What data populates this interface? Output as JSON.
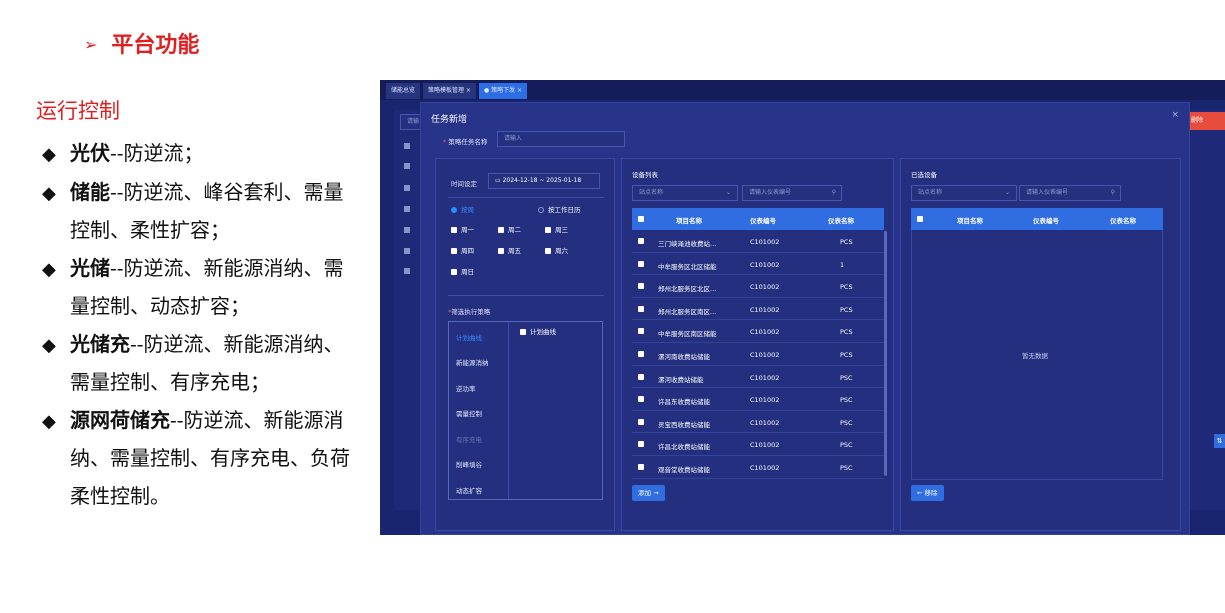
{
  "heading": {
    "arrow": "➢",
    "text": "平台功能"
  },
  "subheading": "运行控制",
  "bullets": [
    {
      "marker": "◆",
      "bold": "光伏",
      "text": "--防逆流；"
    },
    {
      "marker": "◆",
      "bold": "储能",
      "text": "--防逆流、峰谷套利、需量控制、柔性扩容；"
    },
    {
      "marker": "◆",
      "bold": "光储",
      "text": "--防逆流、新能源消纳、需量控制、动态扩容；"
    },
    {
      "marker": "◆",
      "bold": "光储充",
      "text": "--防逆流、新能源消纳、需量控制、有序充电；"
    },
    {
      "marker": "◆",
      "bold": "源网荷储充",
      "text": "--防逆流、新能源消纳、需量控制、有序充电、负荷柔性控制。"
    }
  ],
  "app": {
    "tabs": [
      {
        "label": "储能总览"
      },
      {
        "label": "策略模板管理 ×"
      },
      {
        "label": "● 策略下发 ×"
      }
    ],
    "danger_label": "删除",
    "bg_search": "请输",
    "modal": {
      "title": "任务新增",
      "close": "×",
      "name_label": "策略任务名称",
      "name_req": "*",
      "name_placeholder": "请输入",
      "time_label": "时间设定",
      "date_range": "2024-12-18  ~  2025-01-18",
      "calendar_icon": "calendar-icon",
      "cycle_options": [
        "按周",
        "按工作日历"
      ],
      "weekdays": [
        "周一",
        "周二",
        "周三",
        "周四",
        "周五",
        "周六",
        "周日"
      ],
      "strategy_label": "筛选执行策略",
      "strategy_req": "*",
      "strategies": [
        "计划曲线",
        "新能源消纳",
        "逆功率",
        "需量控制",
        "有序充电",
        "削峰填谷",
        "动态扩容"
      ],
      "strategy_selected": "计划曲线",
      "strategy_check": "计划曲线",
      "device_list": {
        "title": "设备列表",
        "station_placeholder": "站点名称",
        "meter_placeholder": "请输入仪表编号",
        "columns": [
          "项目名称",
          "仪表编号",
          "仪表名称"
        ],
        "rows": [
          [
            "三门峡渑池收费站...",
            "C101002",
            "PCS"
          ],
          [
            "中牟服务区北区储能",
            "C101002",
            "1"
          ],
          [
            "郑州北服务区北区...",
            "C101002",
            "PCS"
          ],
          [
            "郑州北服务区南区...",
            "C101002",
            "PCS"
          ],
          [
            "中牟服务区南区储能",
            "C101002",
            "PCS"
          ],
          [
            "漯河南收费站储能",
            "C101002",
            "PCS"
          ],
          [
            "漯河收费站储能",
            "C101002",
            "PSC"
          ],
          [
            "许昌东收费站储能",
            "C101002",
            "PSC"
          ],
          [
            "灵宝西收费站储能",
            "C101002",
            "PSC"
          ],
          [
            "许昌北收费站储能",
            "C101002",
            "PSC"
          ],
          [
            "观音堂收费站储能",
            "C101002",
            "PSC"
          ]
        ],
        "add_button": "添加 →"
      },
      "selected_list": {
        "title": "已选设备",
        "station_placeholder": "站点名称",
        "meter_placeholder": "请输入仪表编号",
        "columns": [
          "项目名称",
          "仪表编号",
          "仪表名称"
        ],
        "empty": "暂无数据",
        "remove_button": "← 移除"
      }
    }
  }
}
